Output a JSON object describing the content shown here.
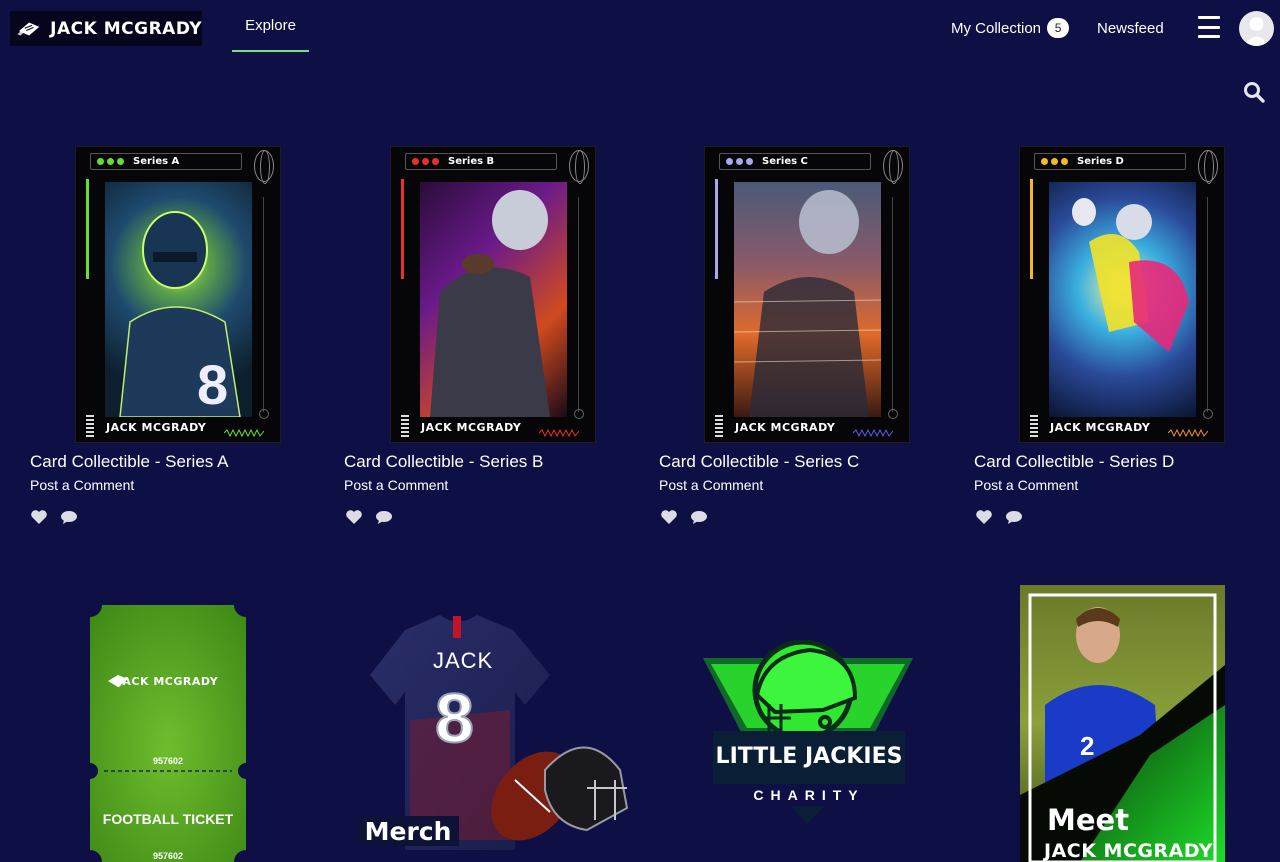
{
  "header": {
    "brand": "JACK MCGRADY",
    "nav_explore": "Explore",
    "my_collection": "My Collection",
    "collection_count": "5",
    "newsfeed": "Newsfeed"
  },
  "cards": [
    {
      "series": "Series A",
      "name": "JACK MCGRADY",
      "title": "Card Collectible - Series A",
      "comment": "Post a Comment",
      "accent": "#5fe033"
    },
    {
      "series": "Series B",
      "name": "JACK MCGRADY",
      "title": "Card Collectible - Series B",
      "comment": "Post a Comment",
      "accent": "#e8302a"
    },
    {
      "series": "Series C",
      "name": "JACK MCGRADY",
      "title": "Card Collectible - Series C",
      "comment": "Post a Comment",
      "accent": "#a6a8f0"
    },
    {
      "series": "Series D",
      "name": "JACK MCGRADY",
      "title": "Card Collectible - Series D",
      "comment": "Post a Comment",
      "accent": "#f2b92a"
    }
  ],
  "tiles": {
    "ticket": {
      "brand": "JACK MCGRADY",
      "number": "957602",
      "label": "FOOTBALL TICKET"
    },
    "merch": {
      "jersey_name": "JACK",
      "jersey_number": "8",
      "label": "Merch"
    },
    "charity": {
      "title": "LITTLE JACKIES",
      "subtitle": "CHARITY"
    },
    "meet": {
      "title": "Meet",
      "subtitle": "JACK MCGRADY",
      "player_number": "2"
    }
  },
  "colors": {
    "background": "#0e0f45",
    "nav_underline": "#72e08c",
    "ticket_green": "#4f9a1e",
    "charity_green": "#2ee92e"
  }
}
